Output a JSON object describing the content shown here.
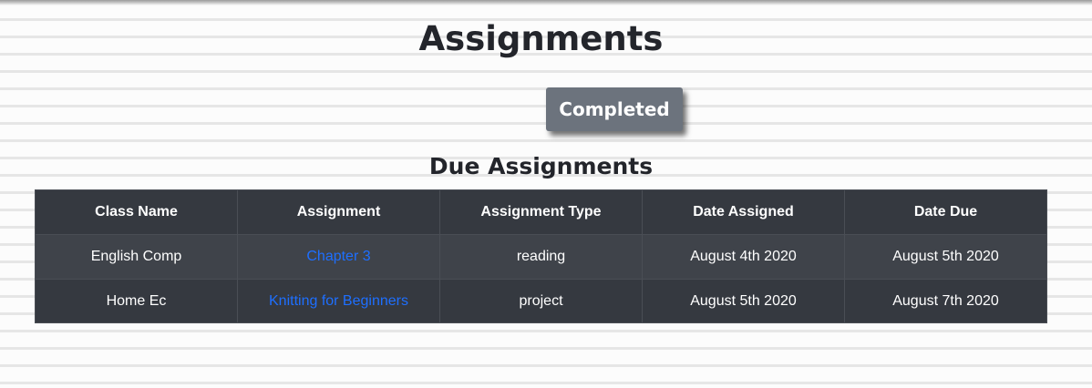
{
  "header": {
    "title": "Assignments"
  },
  "actions": {
    "completed_label": "Completed"
  },
  "due_section": {
    "title": "Due Assignments",
    "columns": [
      "Class Name",
      "Assignment",
      "Assignment Type",
      "Date Assigned",
      "Date Due"
    ],
    "rows": [
      {
        "class_name": "English Comp",
        "assignment": "Chapter 3",
        "type": "reading",
        "date_assigned": "August 4th 2020",
        "date_due": "August 5th 2020"
      },
      {
        "class_name": "Home Ec",
        "assignment": "Knitting for Beginners",
        "type": "project",
        "date_assigned": "August 5th 2020",
        "date_due": "August 7th 2020"
      }
    ]
  },
  "colors": {
    "page_background": "#fcfcfc",
    "paper_line": "#e6e6e6",
    "table_header": "#353940",
    "table_row_odd": "#3f434a",
    "table_row_even": "#353940",
    "link": "#1e6fff",
    "button": "#6c737d",
    "heading_text": "#23252b"
  }
}
